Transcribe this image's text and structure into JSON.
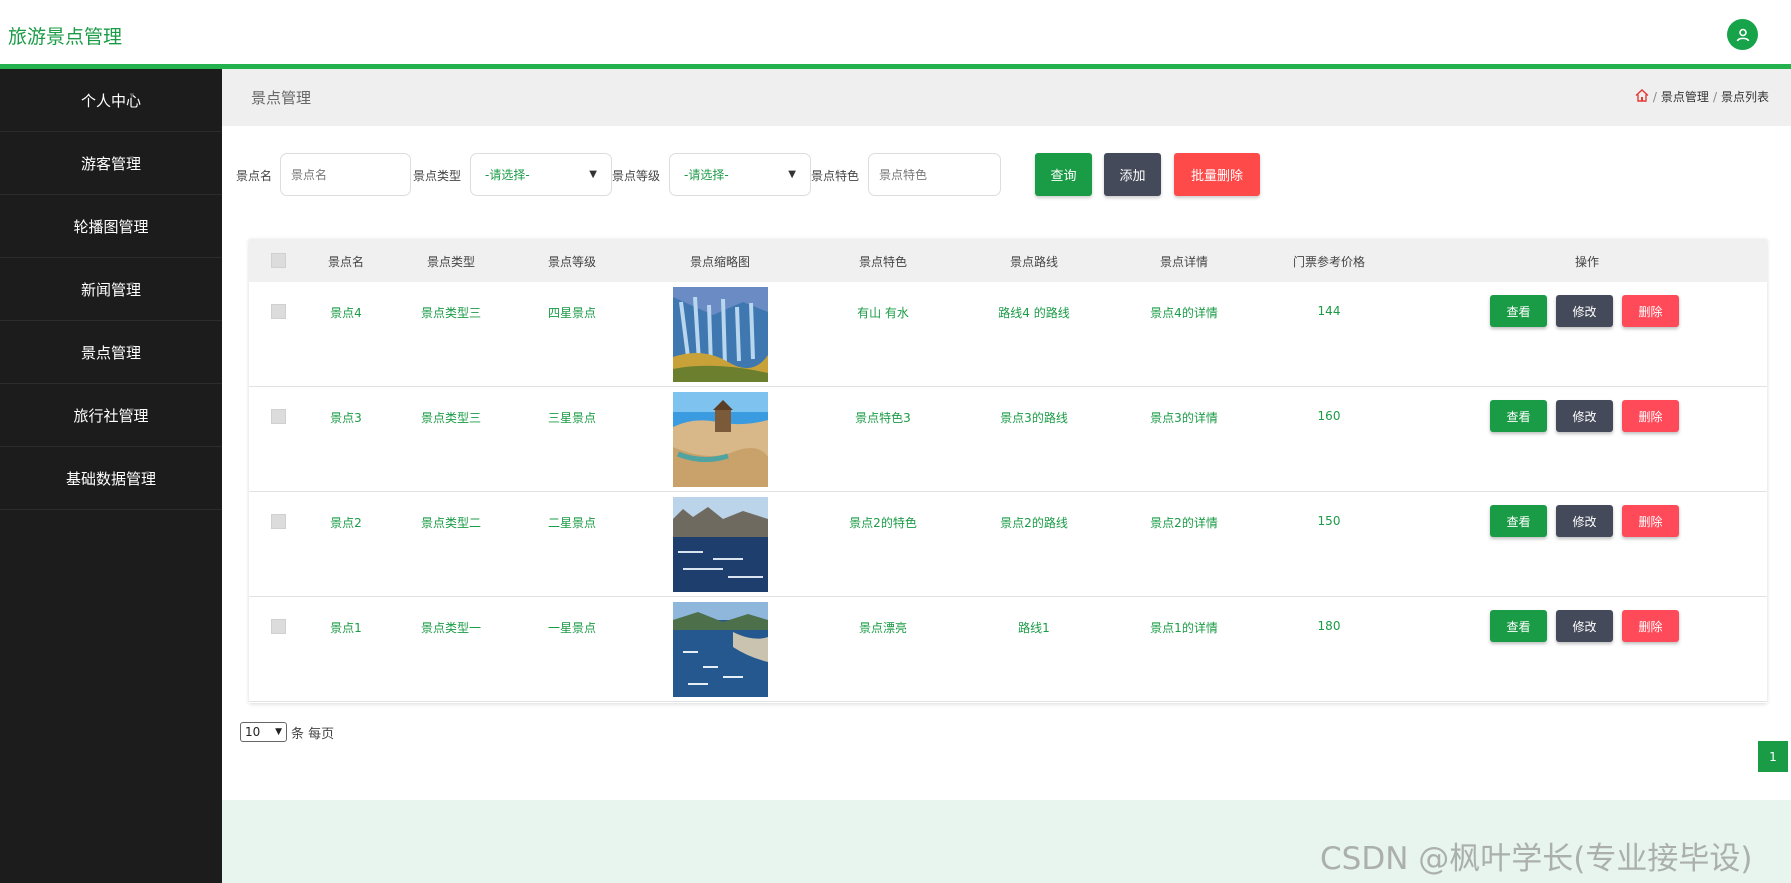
{
  "app": {
    "title": "旅游景点管理"
  },
  "sidebar": {
    "items": [
      {
        "label": "个人中心"
      },
      {
        "label": "游客管理"
      },
      {
        "label": "轮播图管理"
      },
      {
        "label": "新闻管理"
      },
      {
        "label": "景点管理"
      },
      {
        "label": "旅行社管理"
      },
      {
        "label": "基础数据管理"
      }
    ]
  },
  "page": {
    "title": "景点管理",
    "breadcrumbs": [
      "景点管理",
      "景点列表"
    ]
  },
  "filters": {
    "name_label": "景点名",
    "name_placeholder": "景点名",
    "type_label": "景点类型",
    "type_value": "-请选择-",
    "level_label": "景点等级",
    "level_value": "-请选择-",
    "feature_label": "景点特色",
    "feature_placeholder": "景点特色",
    "search_btn": "查询",
    "add_btn": "添加",
    "batch_delete_btn": "批量删除"
  },
  "table": {
    "headers": [
      "景点名",
      "景点类型",
      "景点等级",
      "景点缩略图",
      "景点特色",
      "景点路线",
      "景点详情",
      "门票参考价格",
      "操作"
    ],
    "action_labels": {
      "view": "查看",
      "edit": "修改",
      "delete": "删除"
    },
    "rows": [
      {
        "name": "景点4",
        "type": "景点类型三",
        "level": "四星景点",
        "feature": "有山 有水",
        "route": "路线4 的路线",
        "detail": "景点4的详情",
        "price": "144"
      },
      {
        "name": "景点3",
        "type": "景点类型三",
        "level": "三星景点",
        "feature": "景点特色3",
        "route": "景点3的路线",
        "detail": "景点3的详情",
        "price": "160"
      },
      {
        "name": "景点2",
        "type": "景点类型二",
        "level": "二星景点",
        "feature": "景点2的特色",
        "route": "景点2的路线",
        "detail": "景点2的详情",
        "price": "150"
      },
      {
        "name": "景点1",
        "type": "景点类型一",
        "level": "一星景点",
        "feature": "景点漂亮",
        "route": "路线1",
        "detail": "景点1的详情",
        "price": "180"
      }
    ]
  },
  "pagination": {
    "page_size": "10",
    "per_page_label": "条 每页",
    "current_page": "1"
  },
  "watermark": "CSDN @枫叶学长(专业接毕设)",
  "colors": {
    "accent": "#1a9b46",
    "sidebar_bg": "#1c1c1c",
    "delete": "#ff4a5a",
    "edit": "#444a5a"
  }
}
